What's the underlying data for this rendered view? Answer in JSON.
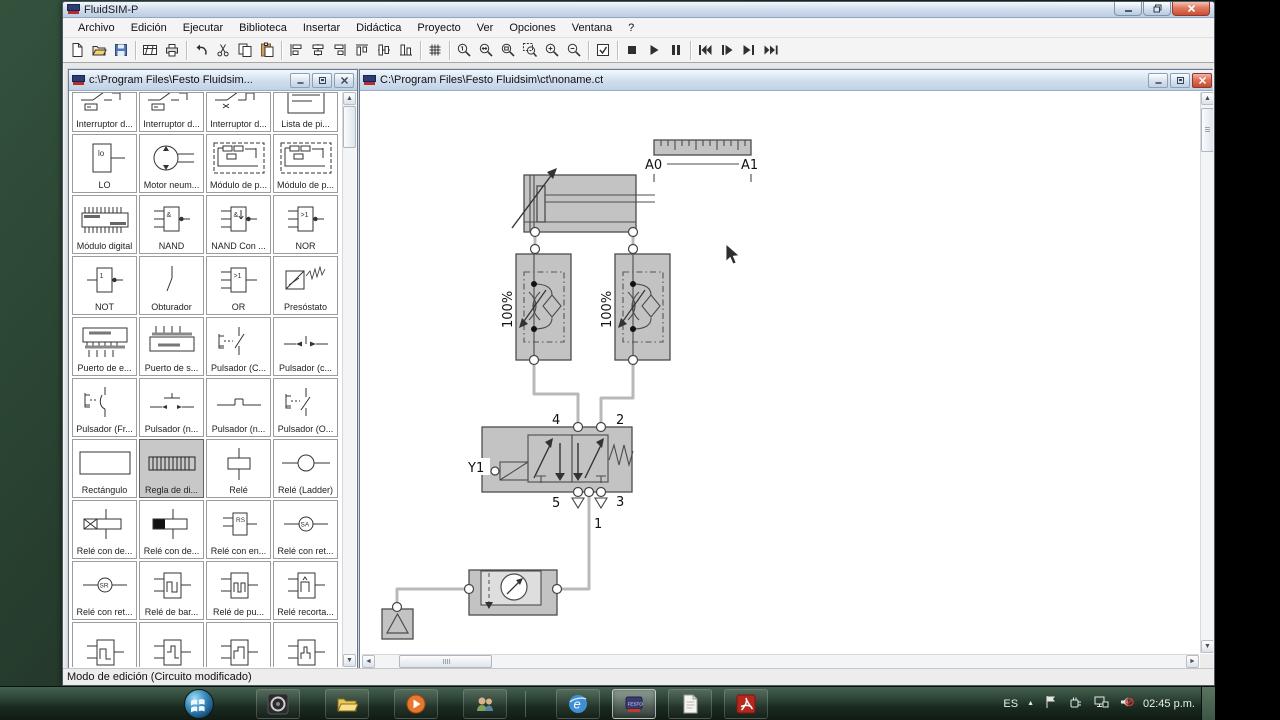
{
  "window": {
    "title": "FluidSIM-P"
  },
  "menu": {
    "items": [
      "Archivo",
      "Edición",
      "Ejecutar",
      "Biblioteca",
      "Insertar",
      "Didáctica",
      "Proyecto",
      "Ver",
      "Opciones",
      "Ventana",
      "?"
    ]
  },
  "toolbar": {
    "groups": [
      [
        "new",
        "open",
        "save"
      ],
      [
        "preview",
        "print"
      ],
      [
        "undo",
        "cut",
        "copy",
        "paste"
      ],
      [
        "align-left",
        "align-center",
        "align-right",
        "align-top",
        "align-middle",
        "align-bottom"
      ],
      [
        "grid"
      ],
      [
        "zoom-100",
        "zoom-fit",
        "zoom-prev",
        "zoom-rect",
        "zoom-in",
        "zoom-out"
      ],
      [
        "check-circuit"
      ],
      [
        "stop",
        "play",
        "pause"
      ],
      [
        "to-start",
        "step",
        "to-end",
        "run-fast"
      ]
    ]
  },
  "library": {
    "title": "c:\\Program Files\\Festo Fluidsim...",
    "rows": [
      {
        "partial": true,
        "cells": [
          {
            "icon": "switch-delay",
            "label": "Interruptor d..."
          },
          {
            "icon": "switch-delay",
            "label": "Interruptor d..."
          },
          {
            "icon": "switch-delay2",
            "label": "Interruptor d..."
          },
          {
            "icon": "list",
            "label": "Lista de pi..."
          }
        ]
      },
      {
        "cells": [
          {
            "icon": "lo-box",
            "label": "LO"
          },
          {
            "icon": "air-motor",
            "label": "Motor neum..."
          },
          {
            "icon": "pneu-module",
            "label": "Módulo de p..."
          },
          {
            "icon": "pneu-module",
            "label": "Módulo de p..."
          }
        ]
      },
      {
        "cells": [
          {
            "icon": "digital-module",
            "label": "Módulo digital"
          },
          {
            "icon": "gate-nand",
            "label": "NAND"
          },
          {
            "icon": "gate-nand-con",
            "label": "NAND Con ..."
          },
          {
            "icon": "gate-nor",
            "label": "NOR"
          }
        ]
      },
      {
        "cells": [
          {
            "icon": "gate-not",
            "label": "NOT"
          },
          {
            "icon": "obturador",
            "label": "Obturador"
          },
          {
            "icon": "gate-or",
            "label": "OR"
          },
          {
            "icon": "presostato",
            "label": "Presóstato"
          }
        ]
      },
      {
        "cells": [
          {
            "icon": "port-in",
            "label": "Puerto de e..."
          },
          {
            "icon": "port-out",
            "label": "Puerto de s..."
          },
          {
            "icon": "pushbutton-c",
            "label": "Pulsador (C..."
          },
          {
            "icon": "pushbutton-close",
            "label": "Pulsador (c..."
          }
        ]
      },
      {
        "cells": [
          {
            "icon": "pushbutton-fr",
            "label": "Pulsador (Fr..."
          },
          {
            "icon": "pushbutton-n1",
            "label": "Pulsador (n..."
          },
          {
            "icon": "pushbutton-n2",
            "label": "Pulsador (n..."
          },
          {
            "icon": "pushbutton-o",
            "label": "Pulsador (O..."
          }
        ]
      },
      {
        "cells": [
          {
            "icon": "rectangle",
            "label": "Rectángulo"
          },
          {
            "icon": "ruler",
            "label": "Regla de di...",
            "selected": true
          },
          {
            "icon": "relay",
            "label": "Relé"
          },
          {
            "icon": "relay-ladder",
            "label": "Relé (Ladder)"
          }
        ]
      },
      {
        "cells": [
          {
            "icon": "relay-delay-x",
            "label": "Relé con de..."
          },
          {
            "icon": "relay-delay-fill",
            "label": "Relé con de..."
          },
          {
            "icon": "relay-rs",
            "label": "Relé con en..."
          },
          {
            "icon": "relay-sa",
            "label": "Relé con ret..."
          }
        ]
      },
      {
        "cells": [
          {
            "icon": "relay-sr",
            "label": "Relé con ret..."
          },
          {
            "icon": "pulse-1",
            "label": "Relé de bar..."
          },
          {
            "icon": "pulse-2",
            "label": "Relé de pu..."
          },
          {
            "icon": "pulse-3",
            "label": "Relé recorta..."
          }
        ]
      },
      {
        "partialBottom": true,
        "cells": [
          {
            "icon": "pulse-4",
            "label": ""
          },
          {
            "icon": "pulse-5",
            "label": ""
          },
          {
            "icon": "pulse-6",
            "label": ""
          },
          {
            "icon": "pulse-7",
            "label": ""
          }
        ]
      }
    ]
  },
  "circuit": {
    "title": "C:\\Program Files\\Festo Fluidsim\\ct\\noname.ct",
    "labels": {
      "a0": "A0",
      "a1": "A1",
      "flow1": "100%",
      "flow2": "100%",
      "y1": "Y1",
      "p4": "4",
      "p2": "2",
      "p5": "5",
      "p3": "3",
      "p1": "1"
    }
  },
  "statusbar": {
    "text": "Modo de edición (Circuito modificado)"
  },
  "taskbar": {
    "apps_left": [
      "media-app",
      "explorer",
      "media-player",
      "contacts"
    ],
    "apps_right": [
      {
        "name": "internet-explorer"
      },
      {
        "name": "fluidsim",
        "active": true
      },
      {
        "name": "notepad"
      },
      {
        "name": "pdf-reader"
      }
    ],
    "tray": {
      "lang": "ES",
      "time": "02:45 p.m."
    }
  }
}
